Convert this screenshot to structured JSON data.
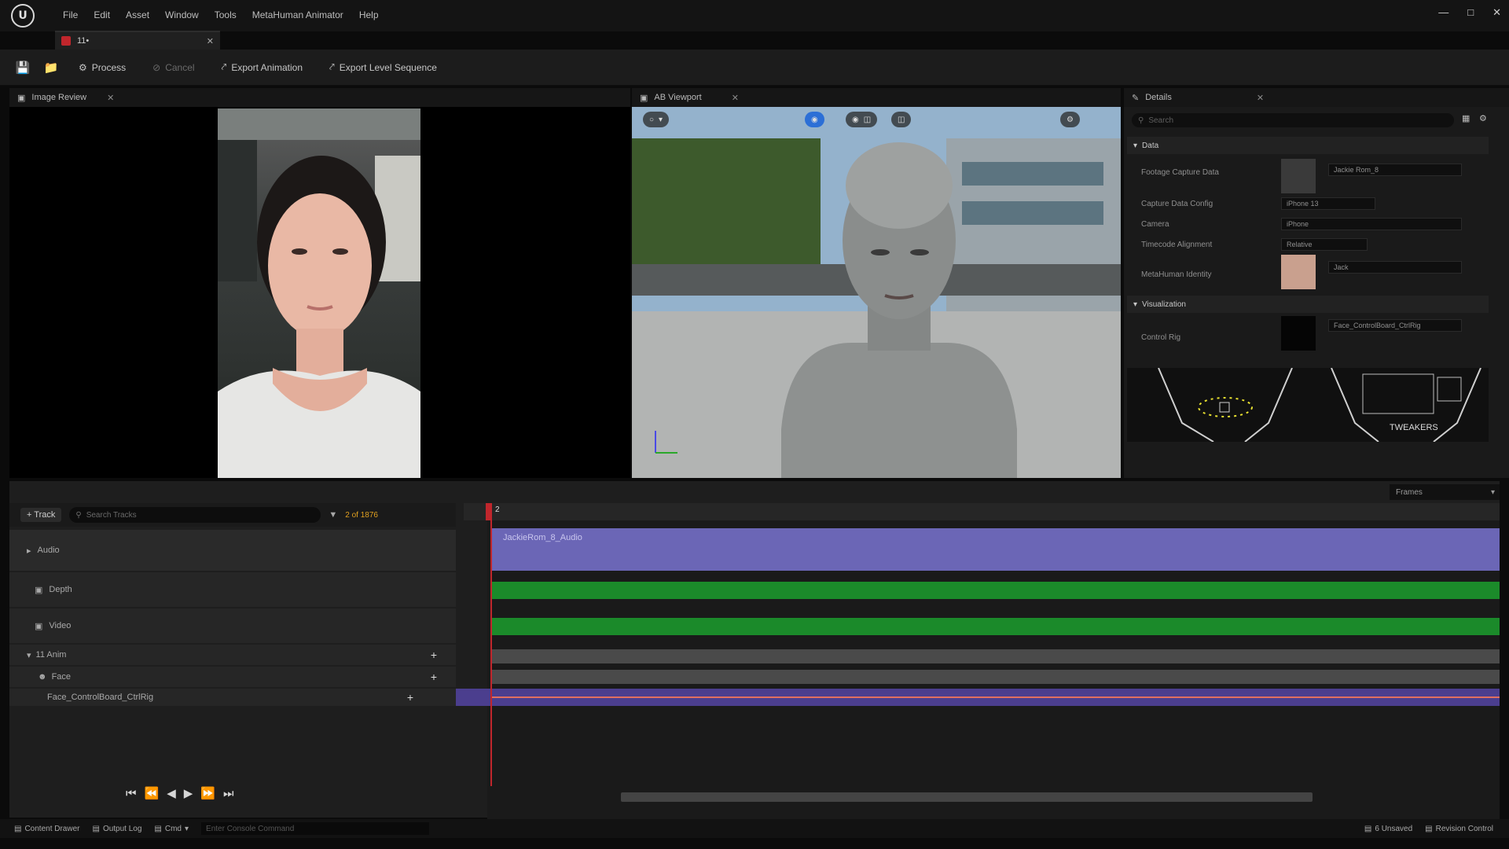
{
  "menu": {
    "items": [
      "File",
      "Edit",
      "Asset",
      "Window",
      "Tools",
      "MetaHuman Animator",
      "Help"
    ]
  },
  "tab": {
    "label": "11•"
  },
  "toolbar": {
    "process_label": "Process",
    "cancel_label": "Cancel",
    "export_animation_label": "Export Animation",
    "export_level_sequence_label": "Export Level Sequence"
  },
  "image_review": {
    "tab_label": "Image Review"
  },
  "viewport": {
    "tab_label": "AB Viewport"
  },
  "details": {
    "tab_label": "Details",
    "search_placeholder": "Search",
    "data_section": "Data",
    "visualization_section": "Visualization",
    "rows": [
      {
        "label": "Footage Capture Data",
        "value": "Jackie Rom_8"
      },
      {
        "label": "Capture Data Config",
        "value": "iPhone 13"
      },
      {
        "label": "Camera",
        "value": "iPhone"
      },
      {
        "label": "Timecode Alignment",
        "value": "Relative"
      },
      {
        "label": "MetaHuman Identity",
        "value": "Jack"
      },
      {
        "label": "Control Rig",
        "value": "Face_ControlBoard_CtrlRig"
      }
    ],
    "tweakers_label": "TWEAKERS",
    "frames_label": "Frames"
  },
  "sequencer": {
    "add_track_label": "+ Track",
    "search_placeholder": "Search Tracks",
    "frame_counter": "2 of 1876",
    "tracks": [
      {
        "name": "Audio"
      },
      {
        "name": "Depth"
      },
      {
        "name": "Video"
      },
      {
        "name": "11 Anim"
      },
      {
        "name": "Face"
      },
      {
        "name": "Face_ControlBoard_CtrlRig"
      }
    ],
    "audio_clip_label": "JackieRom_8_Audio",
    "playhead_label": "2"
  },
  "statusbar": {
    "content_drawer": "Content Drawer",
    "output_log": "Output Log",
    "cmd": "Cmd",
    "console_placeholder": "Enter Console Command",
    "unsaved": "6 Unsaved",
    "revision_control": "Revision Control"
  },
  "colors": {
    "audio_lane": "#6b66b6",
    "depth_lane": "#1b8a2a",
    "video_lane": "#1b8a2a",
    "rig_lane": "#4b3e8e",
    "accent": "#2c6fd6"
  }
}
